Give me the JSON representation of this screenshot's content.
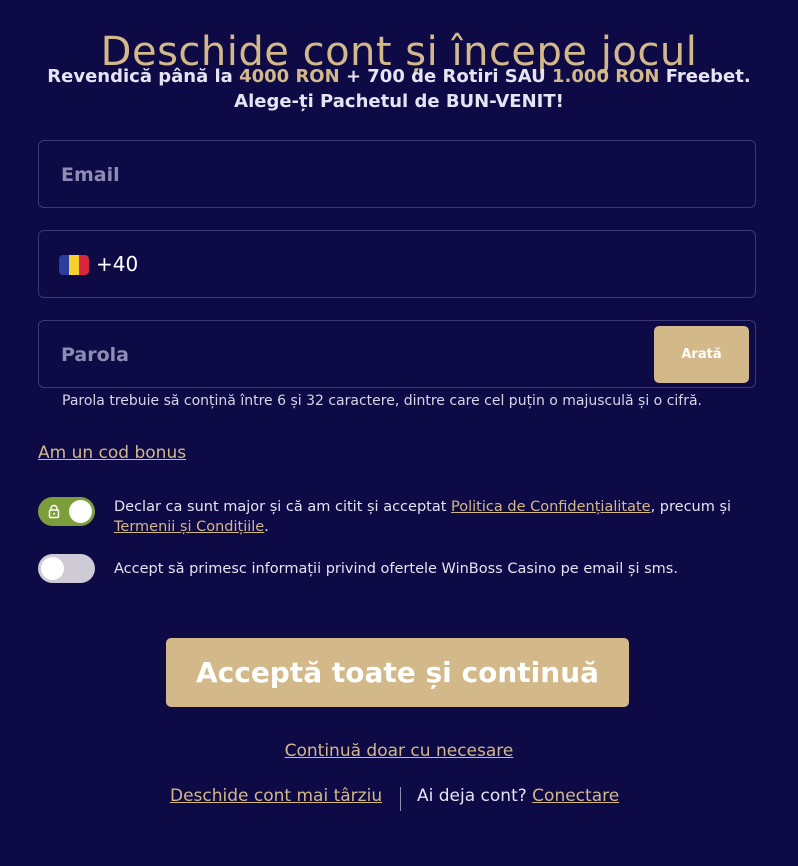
{
  "header": {
    "title": "Deschide cont și începe jocul",
    "promo_part1": "Revendică până la ",
    "promo_amount1": "4000 RON",
    "promo_part2": " + 700 de Rotiri SAU ",
    "promo_amount2": "1.000 RON",
    "promo_part3": " Freebet.",
    "promo_line2": "Alege-ți Pachetul de BUN-VENIT!"
  },
  "form": {
    "email_placeholder": "Email",
    "email_value": "",
    "phone_prefix": "+40",
    "phone_value": "",
    "flag_colors": [
      "#2b3e9e",
      "#f5d12a",
      "#d7263d"
    ],
    "password_placeholder": "Parola",
    "password_value": "",
    "show_password_label": "Arată",
    "password_hint": "Parola trebuie să conțină între 6 și 32 caractere, dintre care cel puțin o majusculă și o cifră.",
    "bonus_code_link": "Am un cod bonus"
  },
  "consents": {
    "terms": {
      "checked": true,
      "locked": true,
      "text_part1": "Declar ca sunt major și că am citit și acceptat ",
      "privacy_link": "Politica de Confidențialitate",
      "text_part2": ", precum și ",
      "terms_link": "Termenii și Condițiile",
      "text_part3": "."
    },
    "marketing": {
      "checked": false,
      "text": "Accept să primesc informații privind ofertele WinBoss Casino pe email și sms."
    }
  },
  "actions": {
    "accept_all_label": "Acceptă toate și continuă",
    "necessary_only_label": "Continuă doar cu necesare",
    "open_later_label": "Deschide cont mai târziu",
    "have_account_label": "Ai deja cont? ",
    "login_label": "Conectare"
  },
  "colors": {
    "background": "#0e0a45",
    "accent_gold": "#d3b889",
    "toggle_on": "#7c9e3a",
    "toggle_off": "#cfcbd6",
    "field_border": "#3c3876"
  }
}
